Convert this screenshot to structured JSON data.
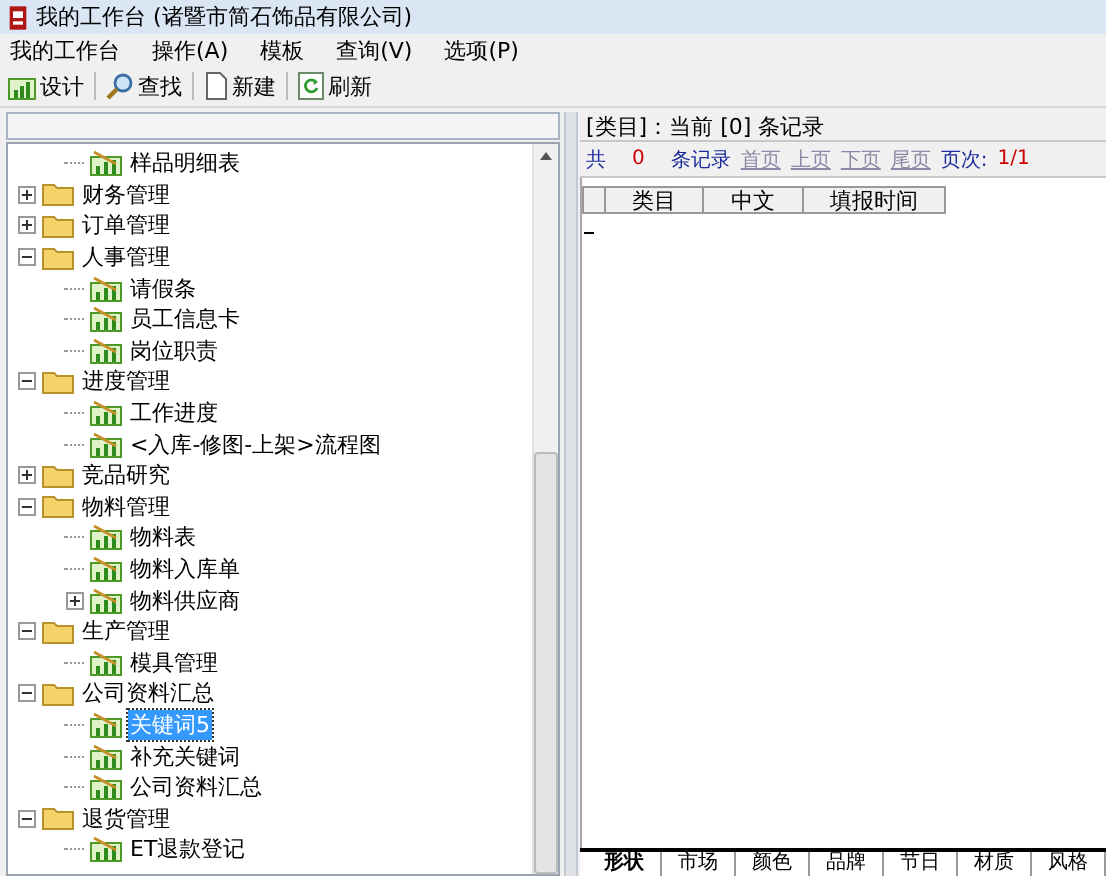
{
  "window": {
    "title": "我的工作台 (诸暨市简石饰品有限公司)"
  },
  "menu": [
    "我的工作台",
    "操作(A)",
    "模板",
    "查询(V)",
    "选项(P)"
  ],
  "toolbar": [
    {
      "kind": "design",
      "label": "设计"
    },
    {
      "kind": "find",
      "label": "查找"
    },
    {
      "kind": "new",
      "label": "新建"
    },
    {
      "kind": "refresh",
      "label": "刷新"
    }
  ],
  "tree": [
    {
      "label": "样品明细表",
      "kind": "report",
      "selected": false
    },
    {
      "label": "财务管理",
      "kind": "folder",
      "expanded": false,
      "selected": false
    },
    {
      "label": "订单管理",
      "kind": "folder",
      "expanded": false,
      "selected": false
    },
    {
      "label": "人事管理",
      "kind": "folder",
      "expanded": true,
      "selected": false,
      "children": [
        {
          "label": "请假条",
          "kind": "report",
          "selected": false
        },
        {
          "label": "员工信息卡",
          "kind": "report",
          "selected": false
        },
        {
          "label": "岗位职责",
          "kind": "report",
          "selected": false
        }
      ]
    },
    {
      "label": "进度管理",
      "kind": "folder",
      "expanded": true,
      "selected": false,
      "children": [
        {
          "label": "工作进度",
          "kind": "report",
          "selected": false
        },
        {
          "label": "<入库-修图-上架>流程图",
          "kind": "report",
          "selected": false
        }
      ]
    },
    {
      "label": "竞品研究",
      "kind": "folder",
      "expanded": false,
      "selected": false
    },
    {
      "label": "物料管理",
      "kind": "folder",
      "expanded": true,
      "selected": false,
      "children": [
        {
          "label": "物料表",
          "kind": "report",
          "selected": false
        },
        {
          "label": "物料入库单",
          "kind": "report",
          "selected": false
        },
        {
          "label": "物料供应商",
          "kind": "report",
          "expanded": false,
          "selected": false
        }
      ]
    },
    {
      "label": "生产管理",
      "kind": "folder",
      "expanded": true,
      "selected": false,
      "children": [
        {
          "label": "模具管理",
          "kind": "report",
          "selected": false
        }
      ]
    },
    {
      "label": "公司资料汇总",
      "kind": "folder",
      "expanded": true,
      "selected": false,
      "children": [
        {
          "label": "关键词5",
          "kind": "report",
          "selected": true
        },
        {
          "label": "补充关键词",
          "kind": "report",
          "selected": false
        },
        {
          "label": "公司资料汇总",
          "kind": "report",
          "selected": false
        }
      ]
    },
    {
      "label": "退货管理",
      "kind": "folder",
      "expanded": true,
      "selected": false,
      "children": [
        {
          "label": "ET退款登记",
          "kind": "report",
          "selected": false
        }
      ]
    }
  ],
  "header": "[类目]：当前 [0] 条记录",
  "pager": {
    "total_label": "共",
    "total": "0",
    "records_label": "条记录",
    "links": [
      "首页",
      "上页",
      "下页",
      "尾页"
    ],
    "page_label": "页次:",
    "page": "1/1"
  },
  "table": {
    "columns": [
      "类目",
      "中文",
      "填报时间"
    ]
  },
  "bottom_tabs": [
    {
      "label": "形状",
      "selected": true
    },
    {
      "label": "市场",
      "selected": false
    },
    {
      "label": "颜色",
      "selected": false
    },
    {
      "label": "品牌",
      "selected": false
    },
    {
      "label": "节日",
      "selected": false
    },
    {
      "label": "材质",
      "selected": false
    },
    {
      "label": "风格",
      "selected": false
    }
  ]
}
